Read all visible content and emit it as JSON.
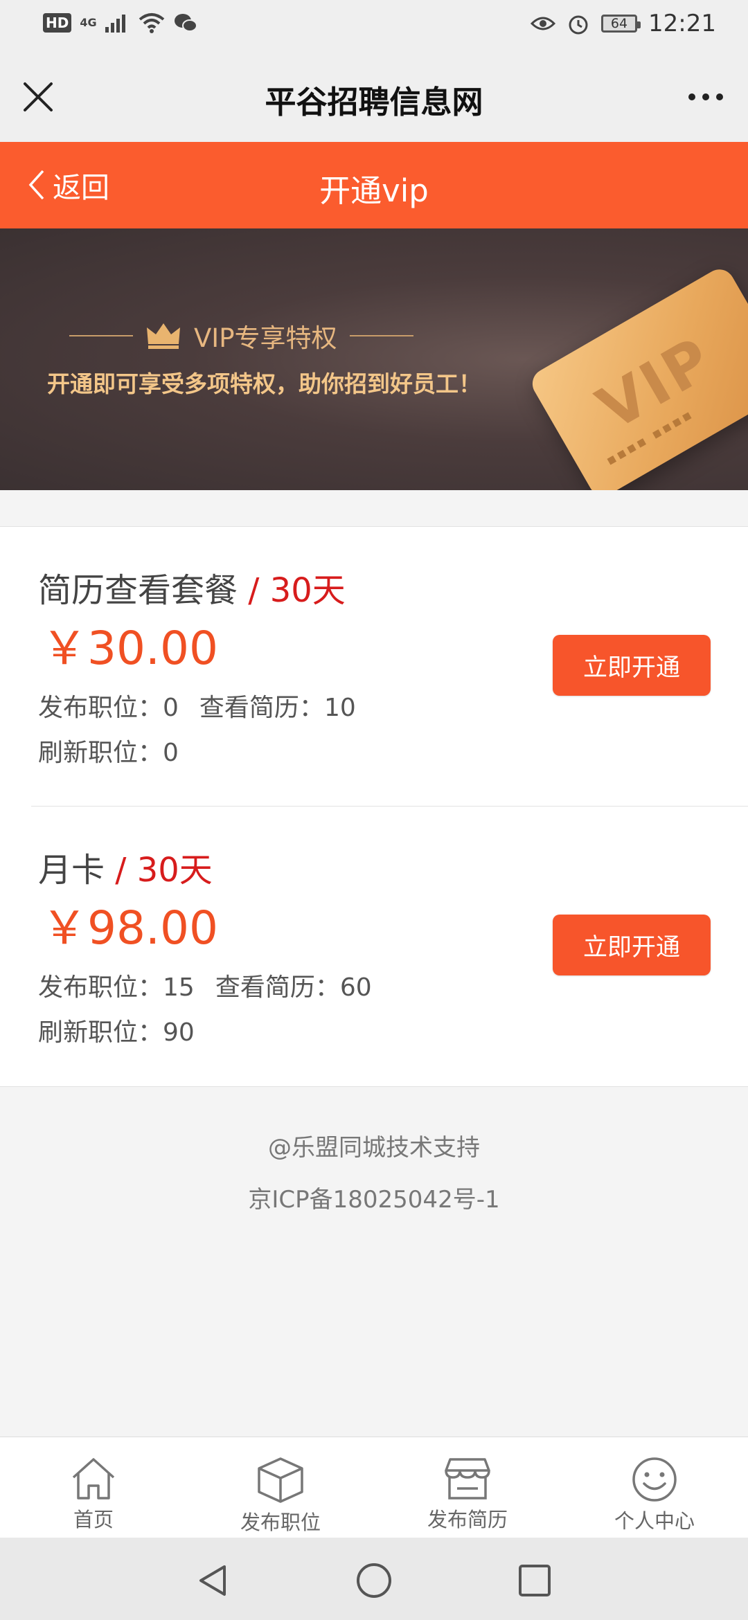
{
  "status_bar": {
    "hd": "HD",
    "network": "4G",
    "battery": "64",
    "time": "12:21"
  },
  "title_bar": {
    "title": "平谷招聘信息网"
  },
  "header": {
    "back_label": "返回",
    "title": "开通vip"
  },
  "banner": {
    "headline": "VIP专享特权",
    "subtitle": "开通即可享受多项特权，助你招到好员工！",
    "card_text": "VIP"
  },
  "plans": [
    {
      "name": "简历查看套餐",
      "duration": " / 30天",
      "price": "￥30.00",
      "stat1_label": "发布职位：",
      "stat1_value": "0",
      "stat2_label": "查看简历：",
      "stat2_value": "10",
      "stat3_label": "刷新职位：",
      "stat3_value": "0",
      "button": "立即开通"
    },
    {
      "name": "月卡",
      "duration": " / 30天",
      "price": "￥98.00",
      "stat1_label": "发布职位：",
      "stat1_value": "15",
      "stat2_label": "查看简历：",
      "stat2_value": "60",
      "stat3_label": "刷新职位：",
      "stat3_value": "90",
      "button": "立即开通"
    }
  ],
  "footer": {
    "support": "@乐盟同城技术支持",
    "icp": "京ICP备18025042号-1"
  },
  "tabs": [
    {
      "label": "首页",
      "icon": "home-icon"
    },
    {
      "label": "发布职位",
      "icon": "box-icon"
    },
    {
      "label": "发布简历",
      "icon": "store-icon"
    },
    {
      "label": "个人中心",
      "icon": "smile-icon"
    }
  ],
  "colors": {
    "accent": "#fb5c2e",
    "price": "#f05023",
    "duration": "#d71c1c"
  }
}
